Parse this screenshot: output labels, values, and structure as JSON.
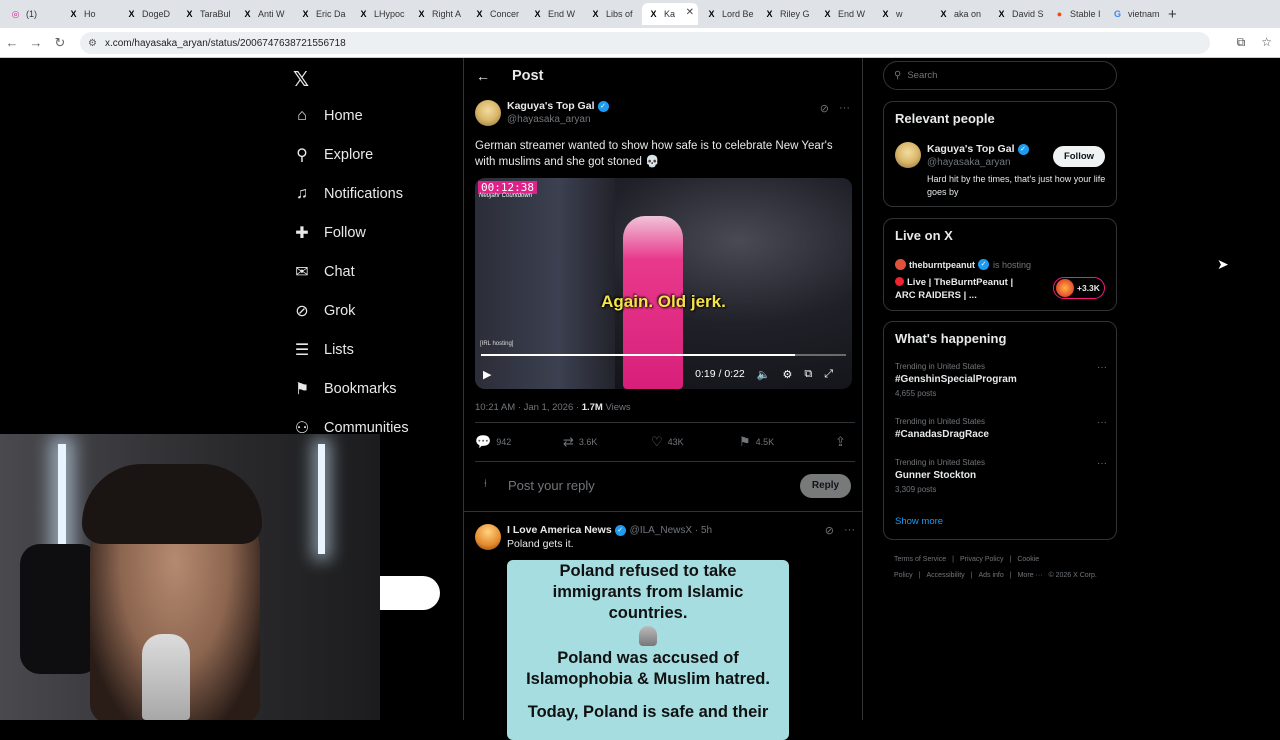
{
  "browser": {
    "tabs": [
      {
        "label": "(1)",
        "icon": "instagram-icon",
        "color": "#d6249f",
        "glyph": "◎"
      },
      {
        "label": "Ho",
        "icon": "x-icon",
        "color": "#000000",
        "glyph": "X"
      },
      {
        "label": "DogeD",
        "icon": "x-icon",
        "color": "#000000",
        "glyph": "X"
      },
      {
        "label": "TaraBul",
        "icon": "x-icon",
        "color": "#000000",
        "glyph": "X"
      },
      {
        "label": "Anti W",
        "icon": "x-icon",
        "color": "#000000",
        "glyph": "X"
      },
      {
        "label": "Eric Da",
        "icon": "x-icon",
        "color": "#000000",
        "glyph": "X"
      },
      {
        "label": "LHypoc",
        "icon": "x-icon",
        "color": "#000000",
        "glyph": "X"
      },
      {
        "label": "Right A",
        "icon": "x-icon",
        "color": "#000000",
        "glyph": "X"
      },
      {
        "label": "Concer",
        "icon": "x-icon",
        "color": "#000000",
        "glyph": "X"
      },
      {
        "label": "End W",
        "icon": "x-icon",
        "color": "#000000",
        "glyph": "X"
      },
      {
        "label": "Libs of",
        "icon": "x-icon",
        "color": "#000000",
        "glyph": "X"
      },
      {
        "label": "Ka",
        "icon": "x-icon",
        "color": "#000000",
        "glyph": "X",
        "active": true
      },
      {
        "label": "Lord Be",
        "icon": "x-icon",
        "color": "#000000",
        "glyph": "X"
      },
      {
        "label": "Riley G",
        "icon": "x-icon",
        "color": "#000000",
        "glyph": "X"
      },
      {
        "label": "End W",
        "icon": "x-icon",
        "color": "#000000",
        "glyph": "X"
      },
      {
        "label": "w",
        "icon": "x-icon",
        "color": "#000000",
        "glyph": "X"
      },
      {
        "label": "aka on",
        "icon": "x-icon",
        "color": "#000000",
        "glyph": "X"
      },
      {
        "label": "David S",
        "icon": "x-icon",
        "color": "#000000",
        "glyph": "X"
      },
      {
        "label": "Stable I",
        "icon": "reddit-icon",
        "color": "#ff4500",
        "glyph": "●"
      },
      {
        "label": "vietnam",
        "icon": "google-icon",
        "color": "#4285f4",
        "glyph": "G"
      }
    ],
    "url": "x.com/hayasaka_aryan/status/2006747638721556718"
  },
  "sidebar": {
    "items": [
      {
        "label": "Home",
        "icon": "home-icon",
        "glyph": "⌂"
      },
      {
        "label": "Explore",
        "icon": "search-icon",
        "glyph": "⚲"
      },
      {
        "label": "Notifications",
        "icon": "bell-icon",
        "glyph": "♫"
      },
      {
        "label": "Follow",
        "icon": "add-person-icon",
        "glyph": "✚"
      },
      {
        "label": "Chat",
        "icon": "mail-icon",
        "glyph": "✉"
      },
      {
        "label": "Grok",
        "icon": "grok-icon",
        "glyph": "⊘"
      },
      {
        "label": "Lists",
        "icon": "list-icon",
        "glyph": "☰"
      },
      {
        "label": "Bookmarks",
        "icon": "bookmark-icon",
        "glyph": "⚑"
      },
      {
        "label": "Communities",
        "icon": "communities-icon",
        "glyph": "⚇"
      }
    ]
  },
  "main": {
    "header_title": "Post",
    "post": {
      "author_name": "Kaguya's Top Gal",
      "author_handle": "@hayasaka_aryan",
      "text": "German streamer wanted to show how safe is to celebrate New Year's with muslims and she got stoned 💀",
      "video": {
        "timer": "00:12:38",
        "timer_sub": "Neujahr Countdown",
        "caption": "Again. Old jerk.",
        "tag": "[IRL hosting]",
        "time": "0:19 / 0:22",
        "progress": 0.86
      },
      "timestamp": "10:21 AM · Jan 1, 2026 · ",
      "views_count": "1.7M",
      "views_label": " Views",
      "replies": "942",
      "reposts": "3.6K",
      "likes": "43K",
      "bookmarks": "4.5K"
    },
    "reply_placeholder": "Post your reply",
    "reply_button": "Reply",
    "reply_post": {
      "author_name": "I Love America News",
      "author_handle": "@ILA_NewsX · 5h",
      "text": "Poland gets it.",
      "image_lines": [
        "Poland refused to take",
        "immigrants from Islamic",
        "countries.",
        "Poland was accused of",
        "Islamophobia & Muslim hatred.",
        "Today, Poland is safe and their"
      ]
    }
  },
  "right": {
    "search_placeholder": "Search",
    "relevant_title": "Relevant people",
    "relevant_name": "Kaguya's Top Gal",
    "relevant_handle": "@hayasaka_aryan",
    "relevant_bio": "Hard hit by the times, that's just how your life goes by",
    "follow_label": "Follow",
    "live_title": "Live on X",
    "live_host": "theburntpeanut",
    "live_status": "is hosting",
    "live_stream_title": "Live | TheBurntPeanut | ARC RAIDERS | ...",
    "live_count": "+3.3K",
    "happening_title": "What's happening",
    "trends": [
      {
        "meta": "Trending in United States",
        "name": "#GenshinSpecialProgram",
        "posts": "4,655 posts"
      },
      {
        "meta": "Trending in United States",
        "name": "#CanadasDragRace",
        "posts": ""
      },
      {
        "meta": "Trending in United States",
        "name": "Gunner Stockton",
        "posts": "3,309 posts"
      }
    ],
    "show_more": "Show more",
    "footer": [
      "Terms of Service",
      "|",
      "Privacy Policy",
      "|",
      "Cookie Policy",
      "|",
      "Accessibility",
      "|",
      "Ads info",
      "|",
      "More ···",
      "© 2026 X Corp."
    ]
  },
  "colors": {
    "accent": "#1d9bf0",
    "background": "#000000",
    "live_red": "#f4212e",
    "video_pink": "#e0218a"
  }
}
